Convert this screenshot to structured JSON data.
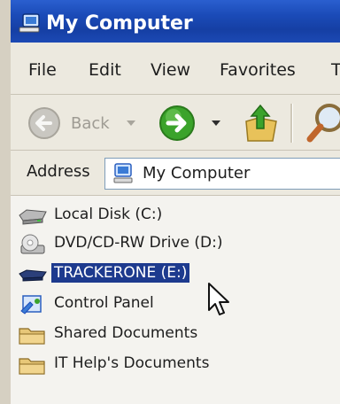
{
  "window": {
    "title": "My Computer",
    "title_icon": "my-computer-icon"
  },
  "menu": {
    "items": [
      "File",
      "Edit",
      "View",
      "Favorites",
      "T"
    ]
  },
  "toolbar": {
    "back_label": "Back",
    "icons": [
      "back-arrow-icon",
      "dropdown-arrow-icon",
      "forward-arrow-icon",
      "dropdown-arrow-icon",
      "up-folder-icon",
      "search-icon"
    ]
  },
  "address": {
    "label": "Address",
    "value": "My Computer",
    "icon": "my-computer-icon"
  },
  "items": [
    {
      "label": "Local Disk (C:)",
      "icon": "hard-drive-icon",
      "selected": false
    },
    {
      "label": "DVD/CD-RW Drive (D:)",
      "icon": "dvd-drive-icon",
      "selected": false
    },
    {
      "label": "TRACKERONE (E:)",
      "icon": "removable-drive-icon",
      "selected": true
    },
    {
      "label": "Control Panel",
      "icon": "control-panel-icon",
      "selected": false
    },
    {
      "label": "Shared Documents",
      "icon": "folder-icon",
      "selected": false
    },
    {
      "label": "IT Help's Documents",
      "icon": "folder-icon",
      "selected": false
    }
  ],
  "colors": {
    "titlebar": "#1b4bb8",
    "selection": "#1d3a8e",
    "forward_button": "#3ba32b"
  }
}
